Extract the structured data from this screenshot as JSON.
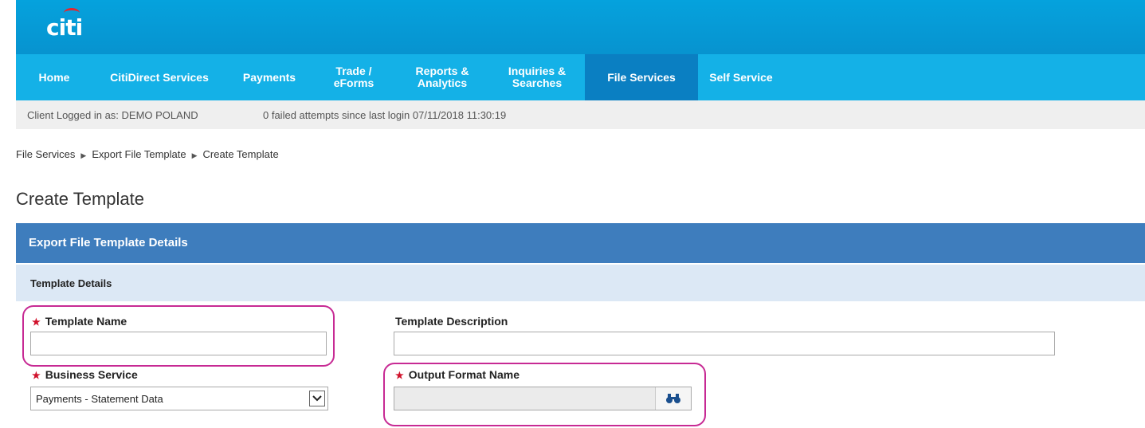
{
  "brand": {
    "logo_text": "citi"
  },
  "nav": {
    "items": [
      {
        "label": "Home"
      },
      {
        "label": "CitiDirect Services"
      },
      {
        "label": "Payments"
      },
      {
        "label": "Trade /\neForms"
      },
      {
        "label": "Reports &\nAnalytics"
      },
      {
        "label": "Inquiries &\nSearches"
      },
      {
        "label": "File Services",
        "active": true
      },
      {
        "label": "Self Service"
      }
    ]
  },
  "login_bar": {
    "client_text": "Client Logged in as: DEMO POLAND",
    "attempts_text": "0 failed attempts since last login 07/11/2018 11:30:19"
  },
  "breadcrumb": [
    "File Services",
    "Export File Template",
    "Create Template"
  ],
  "page_title": "Create Template",
  "panel": {
    "header": "Export File Template Details",
    "section": "Template Details"
  },
  "form": {
    "template_name": {
      "label": "Template Name",
      "value": "",
      "required": true
    },
    "template_description": {
      "label": "Template Description",
      "value": ""
    },
    "business_service": {
      "label": "Business Service",
      "value": "Payments - Statement Data",
      "required": true
    },
    "output_format_name": {
      "label": "Output Format Name",
      "value": "",
      "required": true
    }
  },
  "colors": {
    "brand_blue": "#0793cf",
    "nav_blue": "#14b1e7",
    "nav_active": "#0a7fc2",
    "panel_blue": "#3e7dbd",
    "required_red": "#d0112b",
    "highlight_magenta": "#c72a94"
  },
  "icons": {
    "lookup": "binoculars-icon",
    "select_arrow": "chevron-down-icon"
  }
}
